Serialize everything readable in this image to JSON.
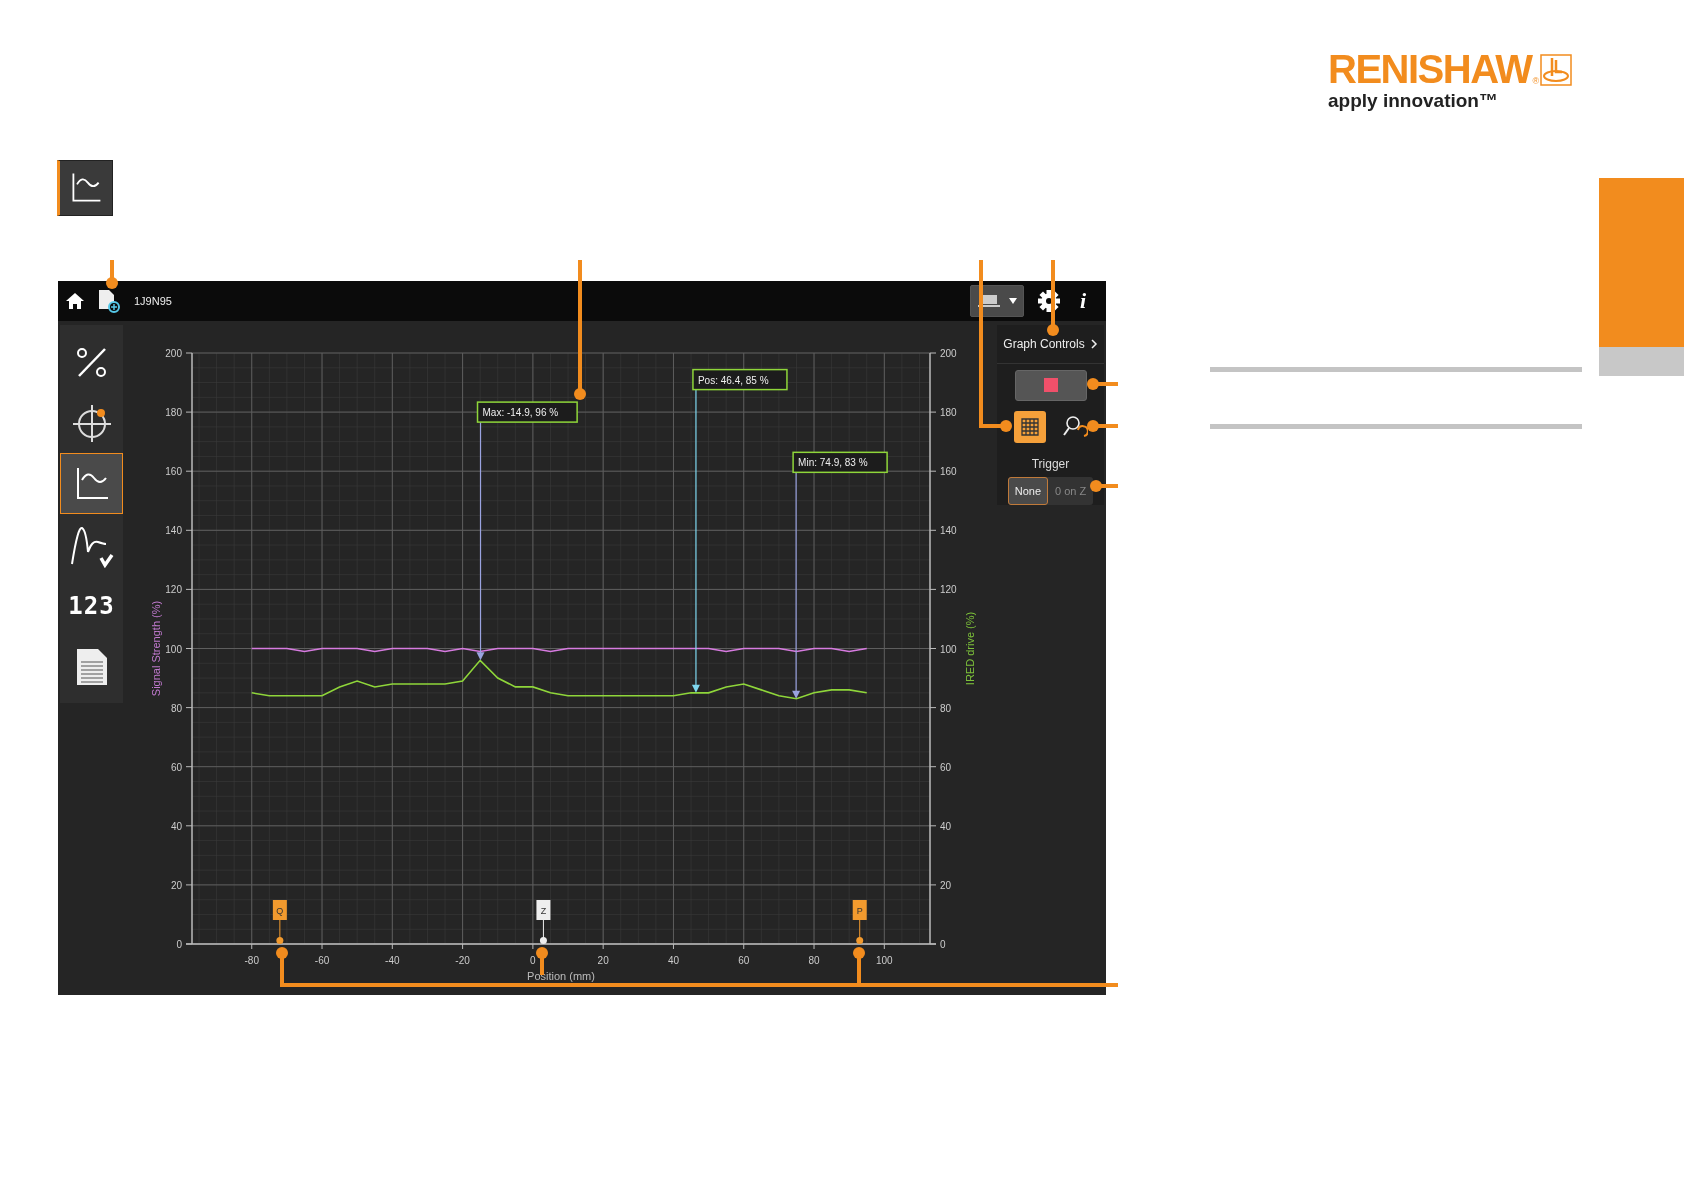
{
  "brand": {
    "name": "RENISHAW",
    "registered": "®",
    "tagline": "apply innovation™"
  },
  "page_icon": {
    "selected": true
  },
  "app": {
    "top_bar": {
      "document_id": "1J9N95",
      "info": "i"
    },
    "nav": [
      {
        "kind": "percent",
        "selected": false
      },
      {
        "kind": "target",
        "selected": false
      },
      {
        "kind": "graph",
        "selected": true
      },
      {
        "kind": "wave",
        "selected": false
      },
      {
        "kind": "digits",
        "label": "123",
        "selected": false
      },
      {
        "kind": "report",
        "selected": false
      }
    ],
    "chart": {
      "chart_data": {
        "type": "line",
        "xlabel": "Position (mm)",
        "ylabel": "Signal Strength (%)",
        "grid": true,
        "x": [
          -80,
          -75,
          -70,
          -65,
          -60,
          -55,
          -50,
          -45,
          -40,
          -35,
          -30,
          -25,
          -20,
          -15,
          -10,
          -5,
          0,
          5,
          10,
          15,
          20,
          25,
          30,
          35,
          40,
          45,
          50,
          55,
          60,
          65,
          70,
          75,
          80,
          85,
          90,
          95
        ],
        "series": [
          {
            "color": "#d77be0",
            "values": [
              100,
              100,
              100,
              99,
              100,
              100,
              100,
              99,
              100,
              100,
              100,
              99,
              100,
              99,
              100,
              100,
              100,
              99,
              100,
              100,
              100,
              100,
              100,
              100,
              100,
              100,
              100,
              99,
              100,
              100,
              100,
              99,
              100,
              100,
              99,
              100
            ]
          },
          {
            "color": "#8fd63a",
            "values": [
              85,
              84,
              84,
              84,
              84,
              87,
              89,
              87,
              88,
              88,
              88,
              88,
              89,
              96,
              90,
              87,
              87,
              85,
              84,
              84,
              84,
              84,
              84,
              84,
              84,
              85,
              85,
              87,
              88,
              86,
              84,
              83,
              85,
              86,
              86,
              85
            ]
          }
        ],
        "xlim": [
          -97,
          113
        ],
        "ylim": [
          0,
          200
        ],
        "xticks": [
          -80,
          -60,
          -40,
          -20,
          0,
          20,
          40,
          60,
          80,
          100
        ],
        "yticks": [
          0,
          20,
          40,
          60,
          80,
          100,
          120,
          140,
          160,
          180,
          200
        ],
        "annotations": [
          {
            "text": "Max: -14.9, 96 %",
            "x": -14.9,
            "y": 96
          },
          {
            "text": "Pos: 46.4, 85 %",
            "x": 46.4,
            "y": 85
          },
          {
            "text": "Min: 74.9, 83 %",
            "x": 74.9,
            "y": 83
          },
          {
            "text": "Q",
            "x": -72
          },
          {
            "text": "Z",
            "x": 3
          },
          {
            "text": "P",
            "x": 93
          }
        ]
      },
      "right_axis": {
        "title": "IRED drive (%)",
        "ticks": [
          "200",
          "180",
          "160",
          "140",
          "120",
          "100",
          "80",
          "60",
          "40",
          "20",
          "0"
        ]
      },
      "markers": [
        {
          "color": "#f29a2e"
        },
        {
          "color": "#eeeeee"
        },
        {
          "color": "#f29a2e"
        }
      ]
    },
    "graph_controls": {
      "title": "Graph Controls",
      "grid": {
        "selected": true
      },
      "trigger": {
        "label": "Trigger",
        "options": [
          {
            "label": "None",
            "selected": true
          },
          {
            "label": "0 on Z",
            "selected": false
          }
        ]
      }
    }
  }
}
